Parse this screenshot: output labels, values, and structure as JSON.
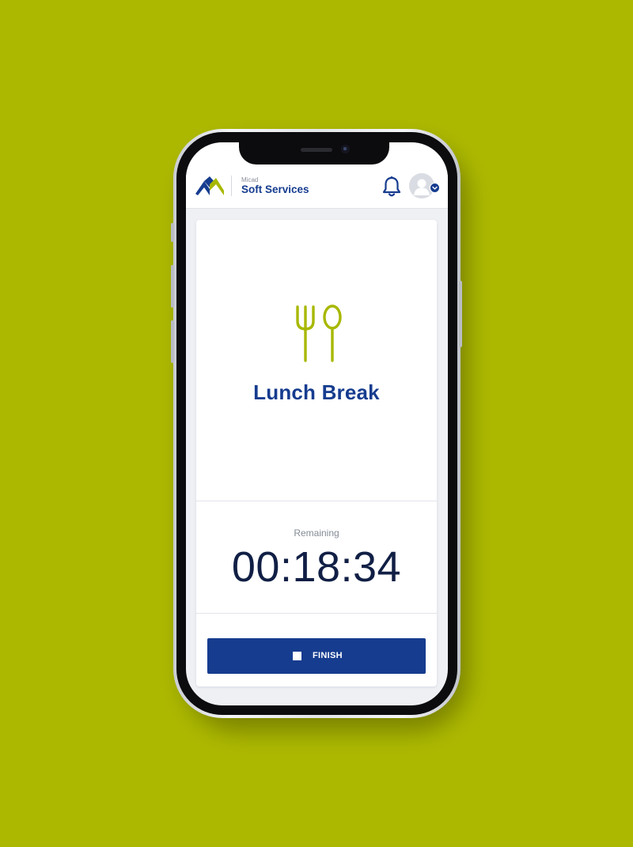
{
  "colors": {
    "background": "#acb800",
    "brand": "#163c8f",
    "accent": "#a8b800",
    "timer": "#111f45"
  },
  "header": {
    "brand_small": "Micad",
    "brand_title": "Soft Services",
    "logo_icon": "micad-logo",
    "bell_icon": "bell-icon",
    "avatar_icon": "user-avatar-icon",
    "avatar_badge_icon": "chevron-down-icon"
  },
  "card": {
    "icon": "fork-spoon-icon",
    "title": "Lunch Break",
    "remaining_label": "Remaining",
    "timer": "00:18:34",
    "finish_button": {
      "icon": "stop-icon",
      "label": "FINISH"
    }
  }
}
